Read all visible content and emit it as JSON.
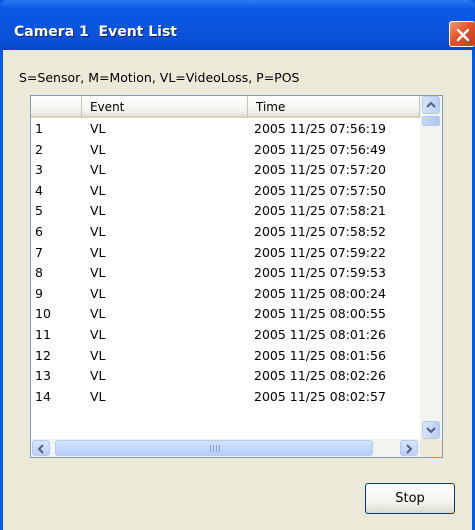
{
  "window": {
    "title": "Camera 1  Event List"
  },
  "legend": "S=Sensor, M=Motion, VL=VideoLoss, P=POS",
  "table": {
    "columns": [
      "",
      "Event",
      "Time"
    ],
    "rows": [
      {
        "num": "1",
        "event": "VL",
        "time": "2005 11/25 07:56:19"
      },
      {
        "num": "2",
        "event": "VL",
        "time": "2005 11/25 07:56:49"
      },
      {
        "num": "3",
        "event": "VL",
        "time": "2005 11/25 07:57:20"
      },
      {
        "num": "4",
        "event": "VL",
        "time": "2005 11/25 07:57:50"
      },
      {
        "num": "5",
        "event": "VL",
        "time": "2005 11/25 07:58:21"
      },
      {
        "num": "6",
        "event": "VL",
        "time": "2005 11/25 07:58:52"
      },
      {
        "num": "7",
        "event": "VL",
        "time": "2005 11/25 07:59:22"
      },
      {
        "num": "8",
        "event": "VL",
        "time": "2005 11/25 07:59:53"
      },
      {
        "num": "9",
        "event": "VL",
        "time": "2005 11/25 08:00:24"
      },
      {
        "num": "10",
        "event": "VL",
        "time": "2005 11/25 08:00:55"
      },
      {
        "num": "11",
        "event": "VL",
        "time": "2005 11/25 08:01:26"
      },
      {
        "num": "12",
        "event": "VL",
        "time": "2005 11/25 08:01:56"
      },
      {
        "num": "13",
        "event": "VL",
        "time": "2005 11/25 08:02:26"
      },
      {
        "num": "14",
        "event": "VL",
        "time": "2005 11/25 08:02:57"
      }
    ]
  },
  "buttons": {
    "stop_label": "Stop"
  },
  "icons": {
    "close": "close-icon",
    "scroll_up": "arrow-up-icon",
    "scroll_down": "arrow-down-icon",
    "scroll_left": "arrow-left-icon",
    "scroll_right": "arrow-right-icon"
  },
  "colors": {
    "title_bar": "#0a54dc",
    "close_button": "#e2542b",
    "dialog_face": "#ece9d8"
  }
}
